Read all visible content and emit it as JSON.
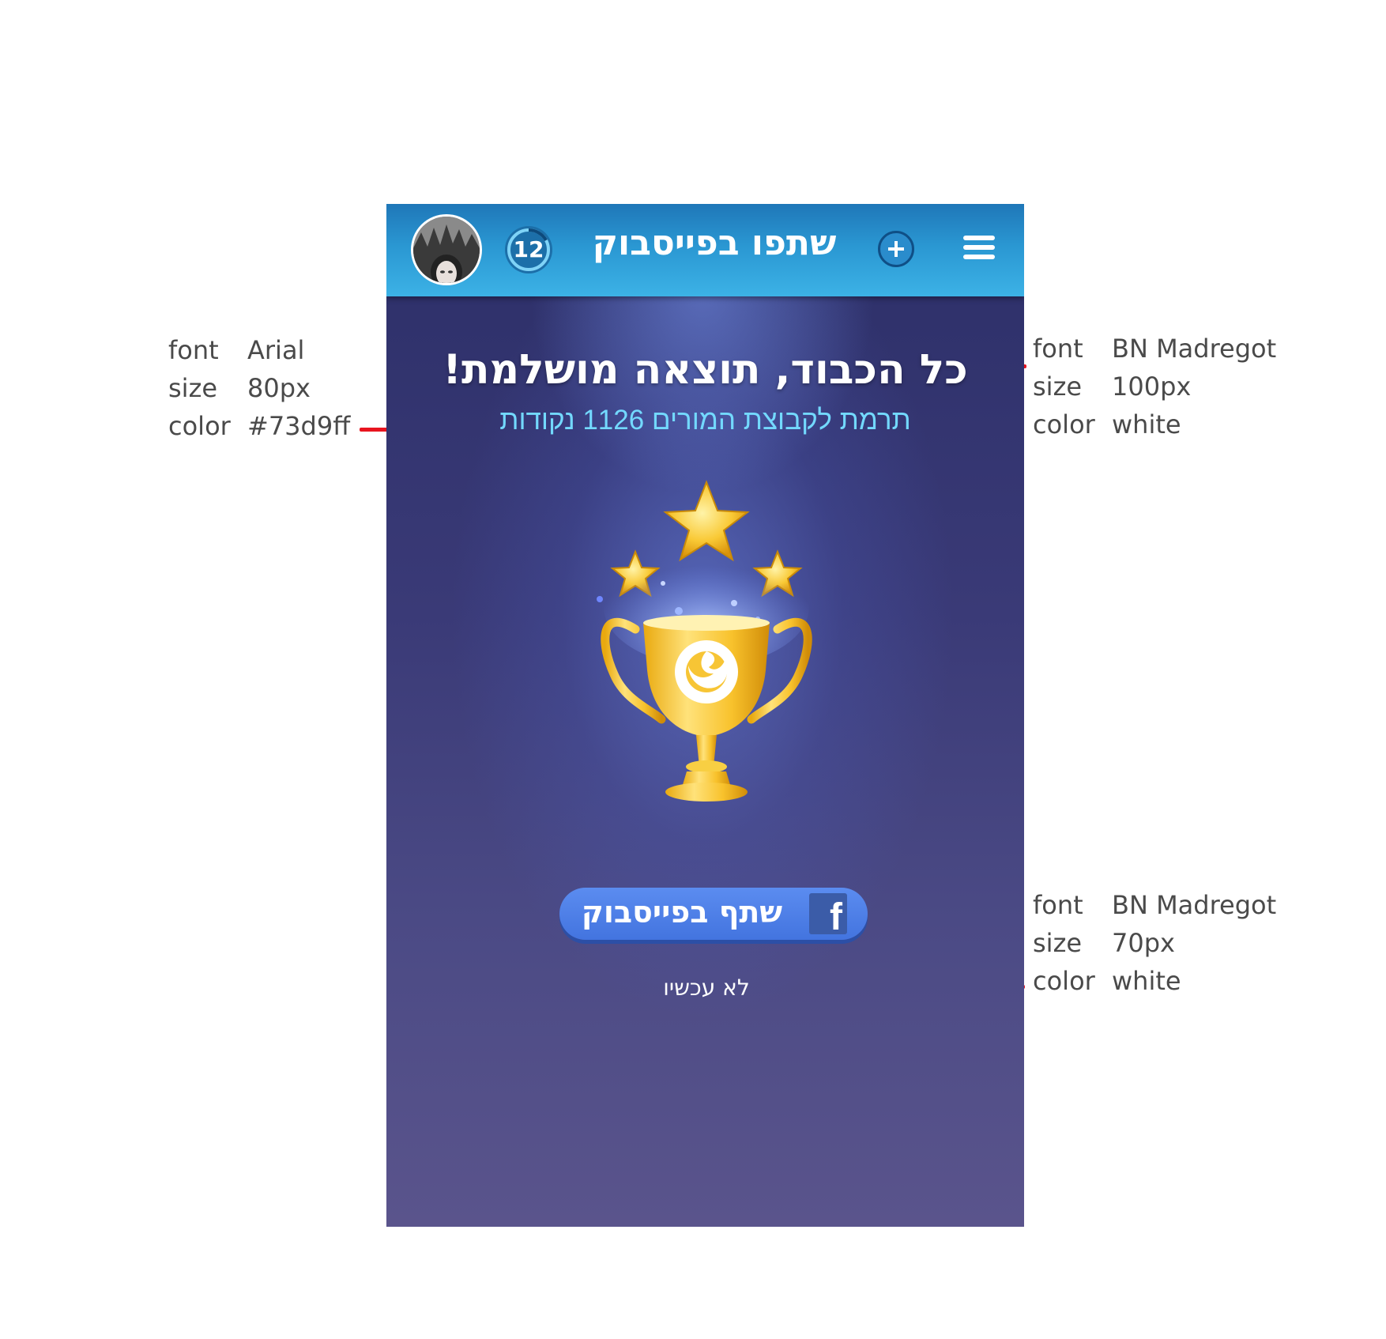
{
  "topbar": {
    "title": "שתפו בפייסבוק",
    "counter": "12"
  },
  "main": {
    "heading": "כל הכבוד, תוצאה מושלמת!",
    "subheading": "תרמת לקבוצת המורים 1126 נקודות"
  },
  "share_button": {
    "label": "שתף בפייסבוק",
    "icon_letter": "f"
  },
  "skip_link": "לא עכשיו",
  "annotations": [
    {
      "font_key": "font",
      "font_val": "Arial",
      "size_key": "size",
      "size_val": "80px",
      "color_key": "color",
      "color_val": "#73d9ff"
    },
    {
      "font_key": "font",
      "font_val": "BN Madregot",
      "size_key": "size",
      "size_val": "100px",
      "color_key": "color",
      "color_val": "white"
    },
    {
      "font_key": "font",
      "font_val": "BN Madregot",
      "size_key": "size",
      "size_val": "70px",
      "color_key": "color",
      "color_val": "white"
    }
  ],
  "colors": {
    "subheading": "#73d9ff",
    "annotation_line": "#e8141f",
    "topbar": "#2a97d2",
    "share_button": "#4a7de6"
  },
  "icons": [
    "avatar",
    "level-counter-icon",
    "plus-icon",
    "menu-icon",
    "star-icon",
    "trophy-icon",
    "facebook-icon"
  ]
}
